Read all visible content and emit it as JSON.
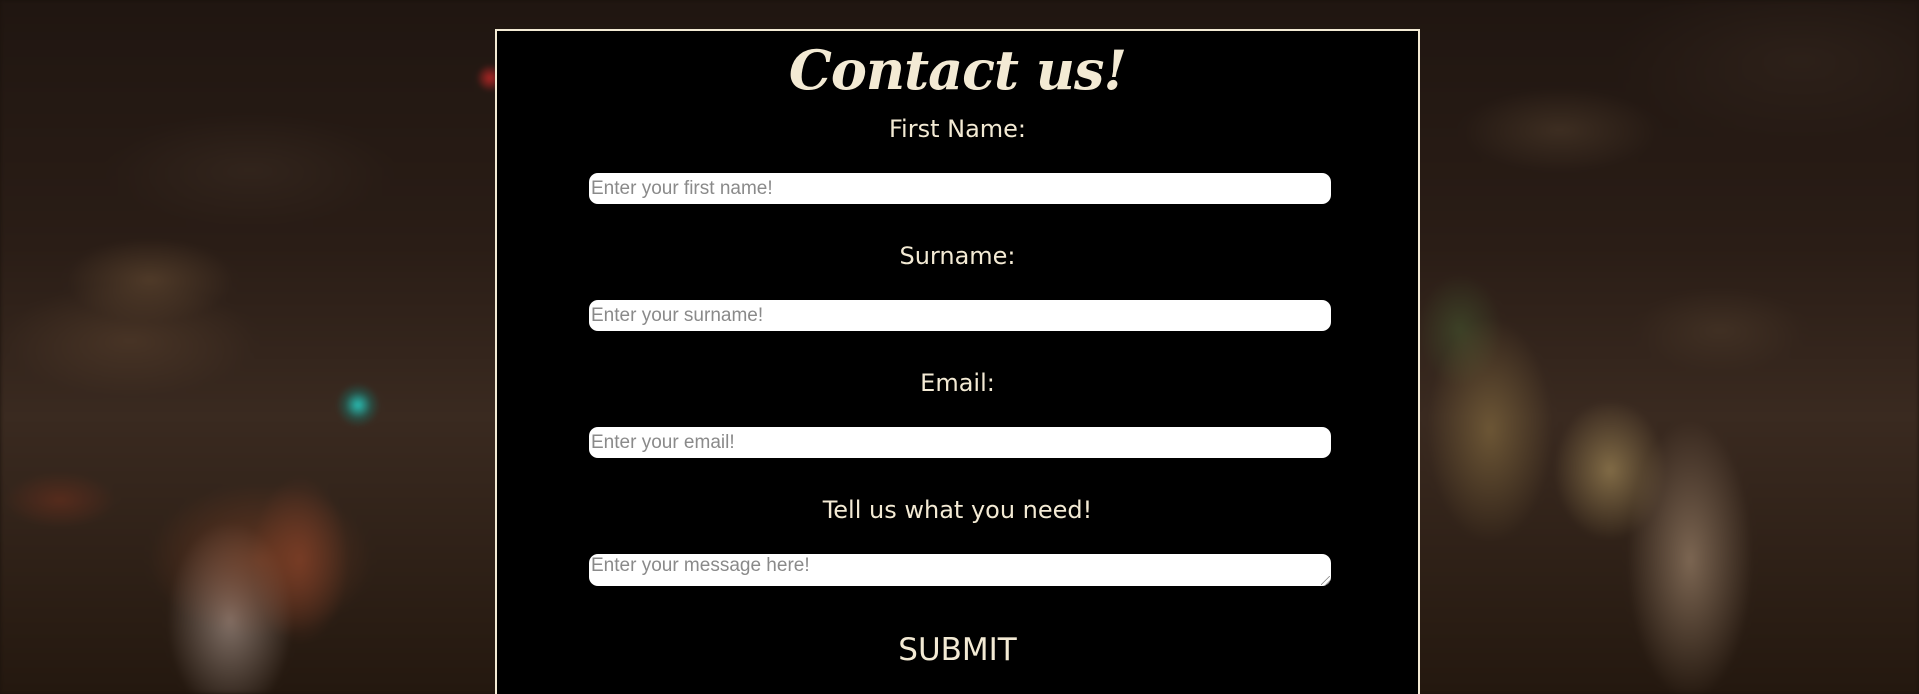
{
  "form": {
    "title": "Contact us!",
    "fields": [
      {
        "label": "First Name:",
        "placeholder": "Enter your first name!",
        "value": ""
      },
      {
        "label": "Surname:",
        "placeholder": "Enter your surname!",
        "value": ""
      },
      {
        "label": "Email:",
        "placeholder": "Enter your email!",
        "value": ""
      },
      {
        "label": "Tell us what you need!",
        "placeholder": "Enter your message here!",
        "value": ""
      }
    ],
    "submit_label": "SUBMIT"
  },
  "colors": {
    "card_background": "#000000",
    "card_border": "#f3ead4",
    "text": "#f3ead4",
    "input_background": "#ffffff",
    "placeholder": "#8a8a8a"
  }
}
